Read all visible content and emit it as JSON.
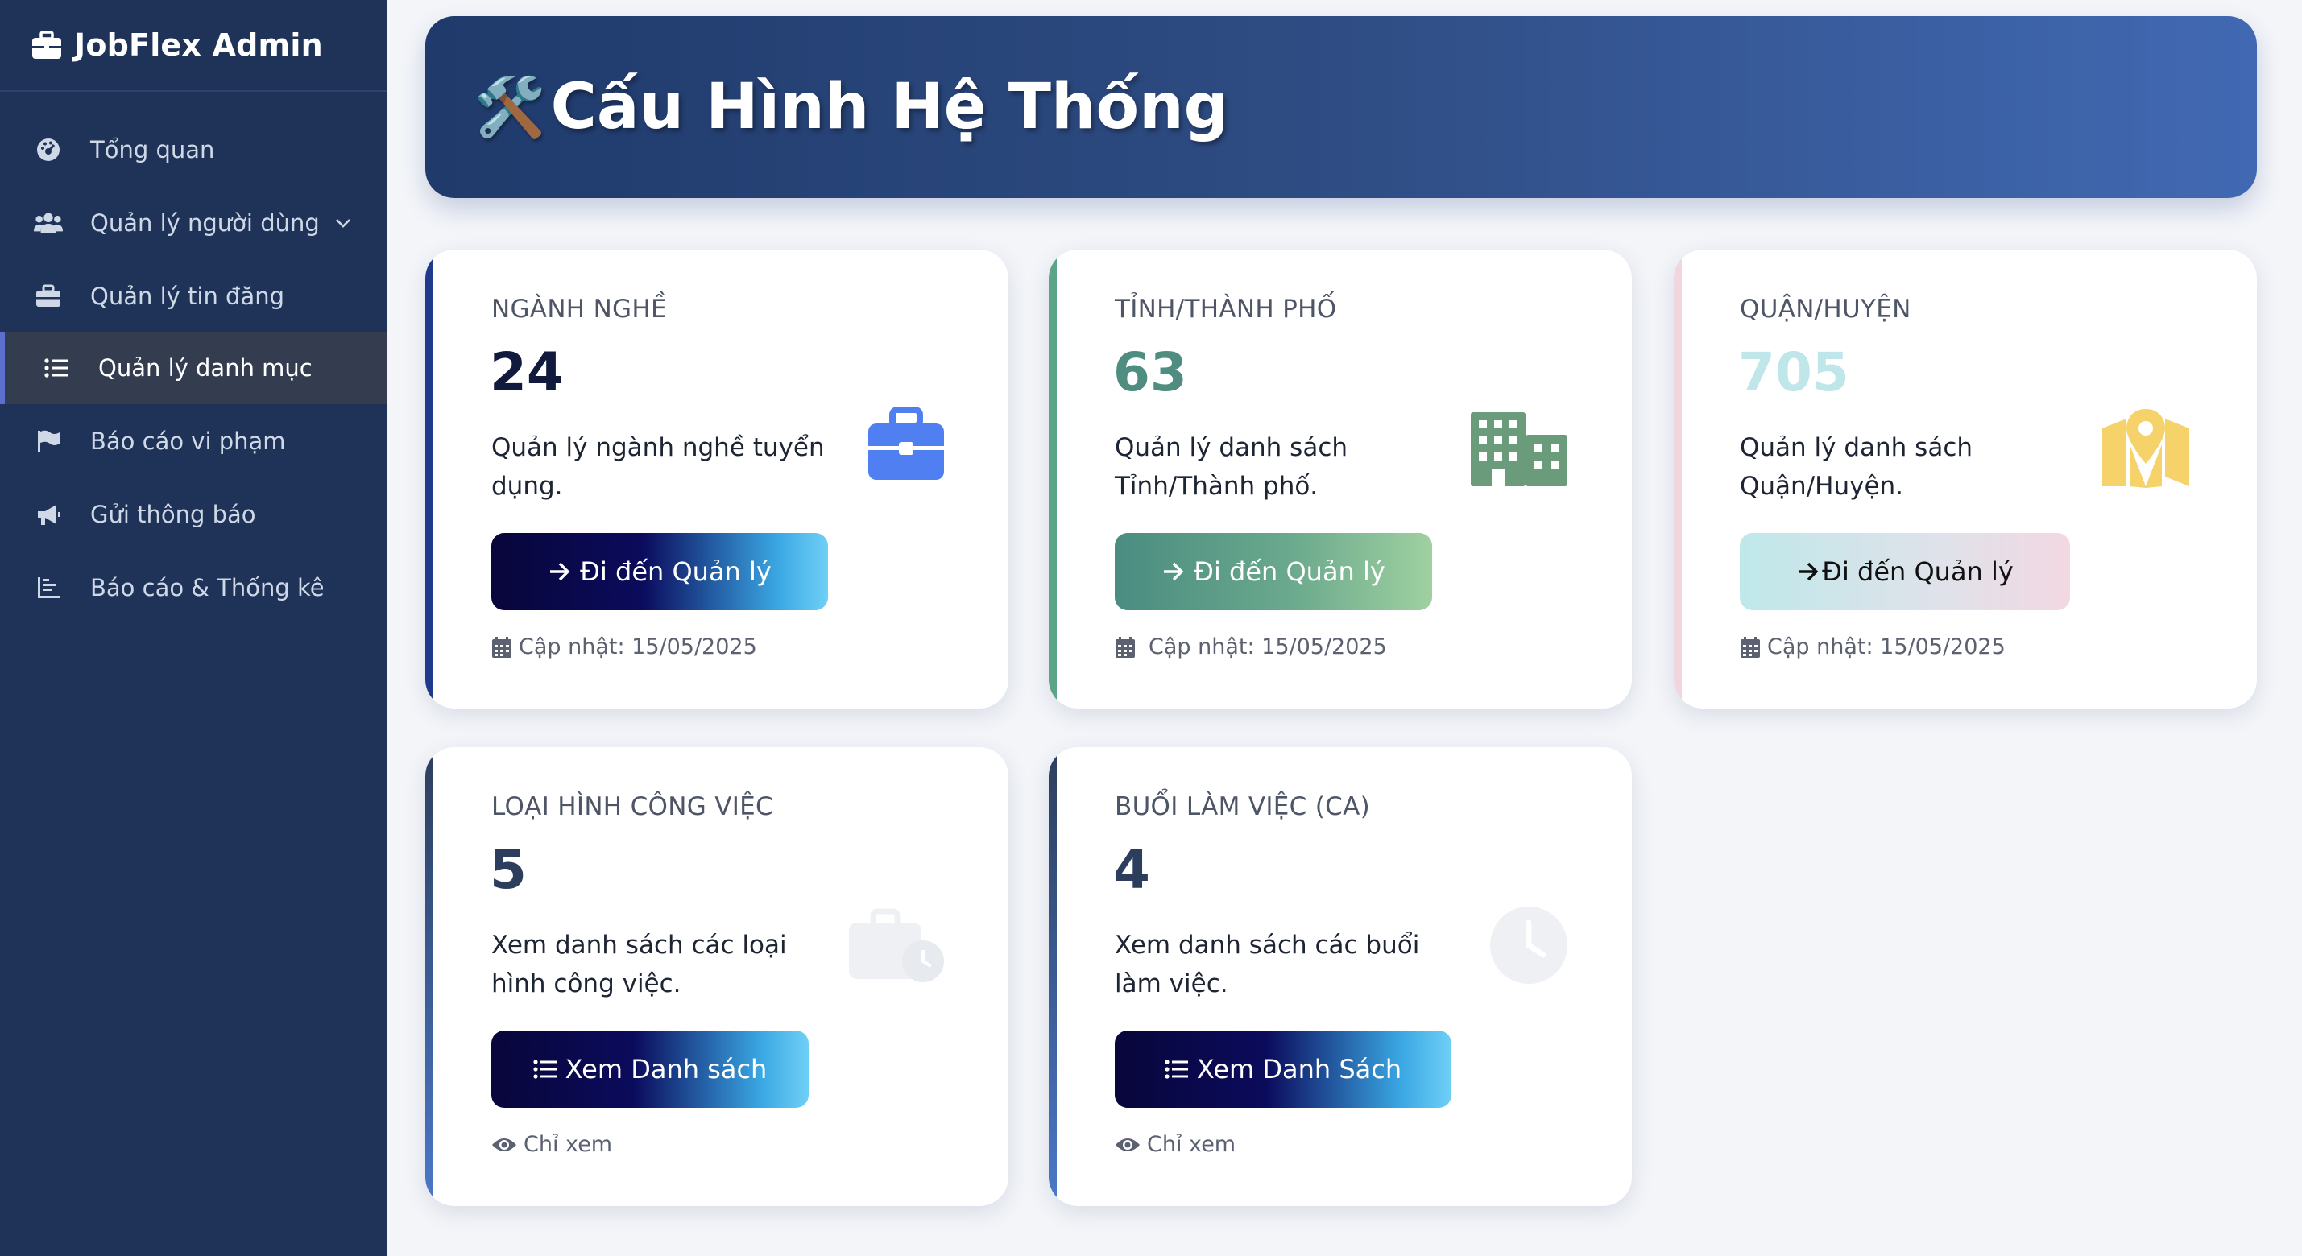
{
  "app": {
    "brand": "JobFlex Admin"
  },
  "sidebar": {
    "items": [
      {
        "label": "Tổng quan",
        "icon": "dashboard-icon"
      },
      {
        "label": "Quản lý người dùng",
        "icon": "users-icon",
        "has_submenu": true
      },
      {
        "label": "Quản lý tin đăng",
        "icon": "briefcase-icon"
      },
      {
        "label": "Quản lý danh mục",
        "icon": "list-icon",
        "active": true
      },
      {
        "label": "Báo cáo vi phạm",
        "icon": "flag-icon"
      },
      {
        "label": "Gửi thông báo",
        "icon": "megaphone-icon"
      },
      {
        "label": "Báo cáo & Thống kê",
        "icon": "chart-icon"
      }
    ]
  },
  "header": {
    "icon": "🛠️",
    "title": "Cấu Hình Hệ Thống"
  },
  "cards": [
    {
      "label": "NGÀNH NGHỀ",
      "count": "24",
      "description": "Quản lý ngành nghề tuyển dụng.",
      "button": "Đi đến Quản lý",
      "footer": "Cập nhật: 15/05/2025",
      "icon": "briefcase-icon",
      "accent_color": "#1f3a8a",
      "count_color": "#111a3d",
      "icon_color": "#4f7ff0"
    },
    {
      "label": "TỈNH/THÀNH PHỐ",
      "count": "63",
      "description": "Quản lý danh sách Tỉnh/Thành phố.",
      "button": "Đi đến Quản lý",
      "footer": "Cập nhật: 15/05/2025",
      "icon": "building-icon",
      "accent_color": "#5aa487",
      "count_color": "#4e8d7f",
      "icon_color": "#6a9b7b"
    },
    {
      "label": "QUẬN/HUYỆN",
      "count": "705",
      "description": "Quản lý danh sách Quận/Huyện.",
      "button": "Đi đến Quản lý",
      "footer": "Cập nhật: 15/05/2025",
      "icon": "map-marker-icon",
      "accent_color": "#f2d6de",
      "count_color": "#bfe6e8",
      "icon_color": "#f5d26a"
    },
    {
      "label": "LOẠI HÌNH CÔNG VIỆC",
      "count": "5",
      "description": "Xem danh sách các loại hình công việc.",
      "button": "Xem Danh sách",
      "footer": "Chỉ xem",
      "icon": "briefcase-clock-icon",
      "accent_color": "#3c5a8e",
      "count_color": "#2c3e5c",
      "icon_color": "#eef0f3"
    },
    {
      "label": "BUỔI LÀM VIỆC (CA)",
      "count": "4",
      "description": "Xem danh sách các buổi làm việc.",
      "button": "Xem Danh Sách",
      "footer": "Chỉ xem",
      "icon": "clock-icon",
      "accent_color": "#3c5a8e",
      "count_color": "#2c3e5c",
      "icon_color": "#eef0f3"
    }
  ]
}
